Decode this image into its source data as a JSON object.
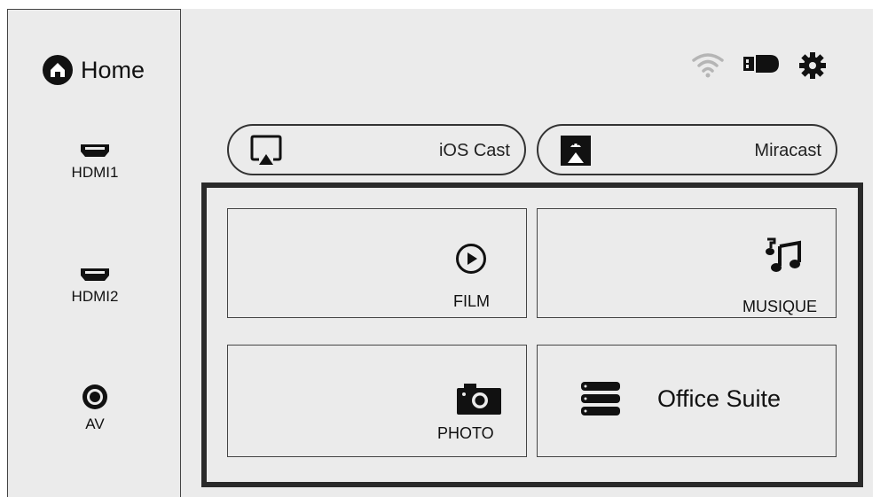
{
  "sidebar": {
    "home_label": "Home",
    "sources": [
      {
        "label": "HDMI1",
        "icon": "hdmi-port-icon"
      },
      {
        "label": "HDMI2",
        "icon": "hdmi-port-icon"
      },
      {
        "label": "AV",
        "icon": "av-port-icon"
      }
    ]
  },
  "status": {
    "icons": [
      "wifi-icon",
      "usb-drive-icon",
      "settings-gear-icon"
    ]
  },
  "cast": {
    "ios_label": "iOS Cast",
    "miracast_label": "Miracast"
  },
  "tiles": {
    "film_label": "FILM",
    "music_label": "MUSIQUE",
    "photo_label": "PHOTO",
    "office_label": "Office Suite"
  }
}
